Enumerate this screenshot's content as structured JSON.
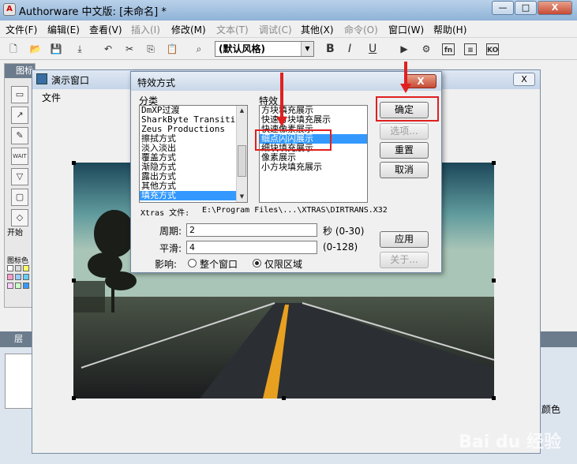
{
  "app": {
    "title": "Authorware 中文版: [未命名] *",
    "icon_label": "A"
  },
  "window_buttons": {
    "minimize": "—",
    "maximize": "□",
    "close": "X"
  },
  "menubar": [
    {
      "label": "文件(F)",
      "disabled": false
    },
    {
      "label": "编辑(E)",
      "disabled": false
    },
    {
      "label": "查看(V)",
      "disabled": false
    },
    {
      "label": "插入(I)",
      "disabled": true
    },
    {
      "label": "修改(M)",
      "disabled": false
    },
    {
      "label": "文本(T)",
      "disabled": true
    },
    {
      "label": "调试(C)",
      "disabled": true
    },
    {
      "label": "其他(X)",
      "disabled": false
    },
    {
      "label": "命令(O)",
      "disabled": true
    },
    {
      "label": "窗口(W)",
      "disabled": false
    },
    {
      "label": "帮助(H)",
      "disabled": false
    }
  ],
  "toolbar": {
    "style_select": "(默认风格)",
    "bold": "B",
    "italic": "I",
    "underline": "U",
    "fn_label": "fn",
    "ko_label": "KO"
  },
  "palette": {
    "title": "图标",
    "start_label": "开始",
    "colors_label": "图标色",
    "wait_label": "WAIT"
  },
  "design_window": {
    "title": "层"
  },
  "presentation": {
    "title": "演示窗口",
    "menu_file": "文件",
    "close": "X"
  },
  "dialog": {
    "title": "特效方式",
    "close": "X",
    "category_label": "分类",
    "effect_label": "特效",
    "categories": [
      "DmXP过渡",
      "SharkByte Transitio",
      "Zeus Productions",
      "擦拭方式",
      "淡入淡出",
      "覆盖方式",
      "渐隐方式",
      "露出方式",
      "其他方式",
      "填充方式"
    ],
    "selected_category": 9,
    "effects": [
      "方块填充展示",
      "快速方块填充展示",
      "快速像素展示",
      "细点闪闪展示",
      "细块填充展示",
      "像素展示",
      "小方块填充展示"
    ],
    "selected_effect": 3,
    "xtras_label": "Xtras 文件:",
    "xtras_path": "E:\\Program Files\\...\\XTRAS\\DIRTRANS.X32",
    "period_label": "周期:",
    "period_value": "2",
    "period_unit": "秒 (0-30)",
    "smooth_label": "平滑:",
    "smooth_value": "4",
    "smooth_range": "(0-128)",
    "affect_label": "影响:",
    "affect_whole": "整个窗口",
    "affect_region": "仅限区域",
    "affect_selected": "region",
    "buttons": {
      "ok": "确定",
      "options": "选项...",
      "reset": "重置",
      "cancel": "取消",
      "apply": "应用",
      "about": "关于..."
    }
  },
  "side_label": "颜色",
  "watermark": "Bai du 经验"
}
